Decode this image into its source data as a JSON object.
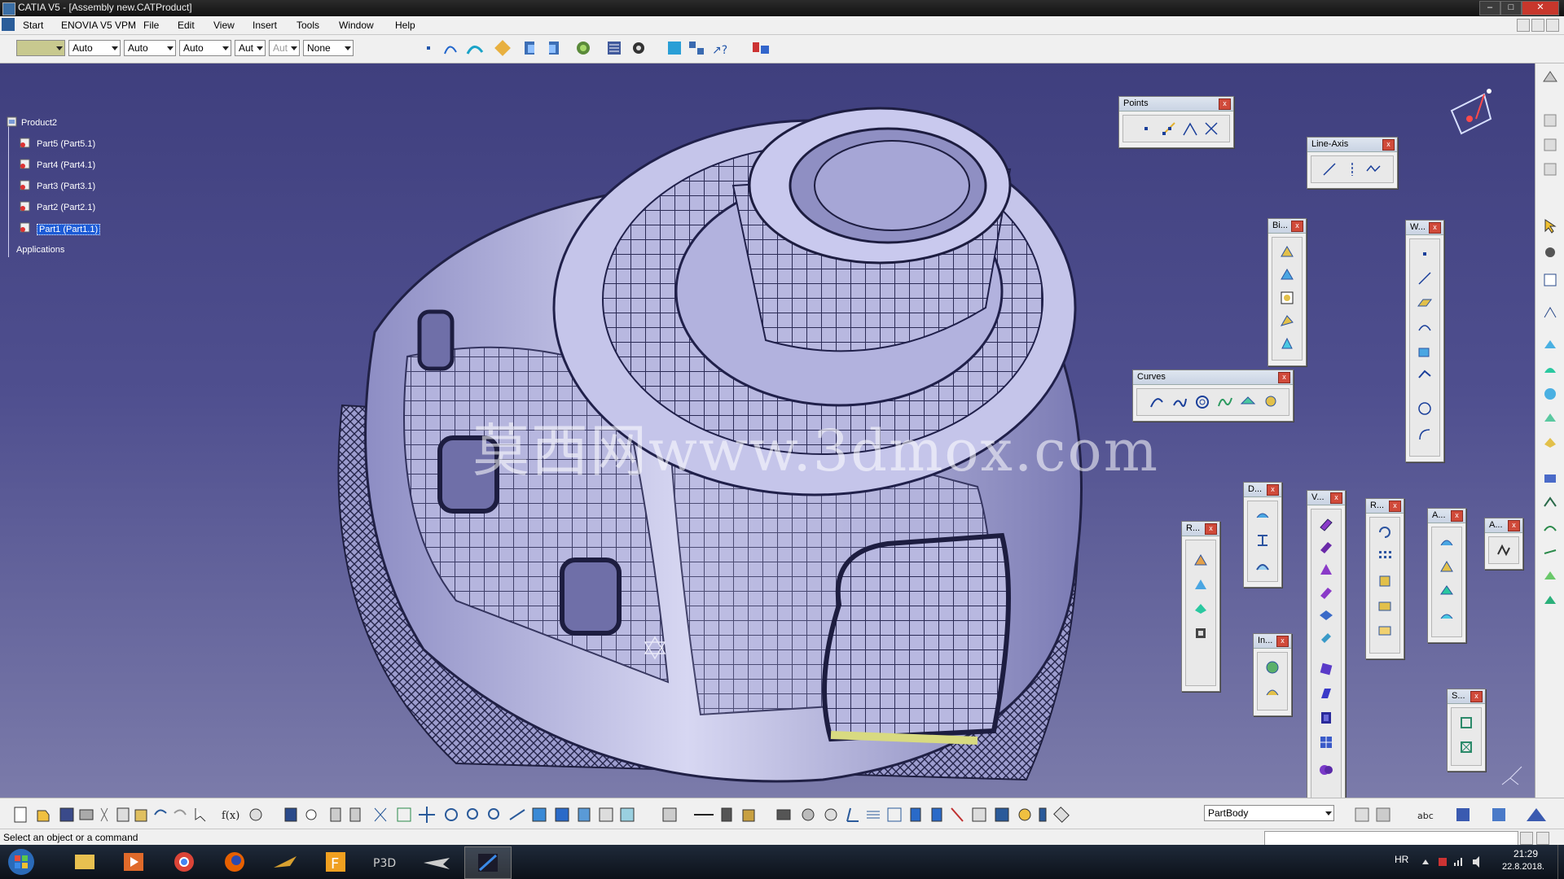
{
  "window": {
    "title": "CATIA V5 - [Assembly new.CATProduct]",
    "min_label": "–",
    "max_label": "□",
    "close_label": "✕"
  },
  "menubar": {
    "items": [
      "Start",
      "ENOVIA V5 VPM",
      "File",
      "Edit",
      "View",
      "Insert",
      "Tools",
      "Window",
      "Help"
    ]
  },
  "toolbar": {
    "color_value": "",
    "line_type": "Auto",
    "line_weight": "Auto",
    "layer": "Auto",
    "combo4": "Aut",
    "combo5": "Aut",
    "none_value": "None"
  },
  "tree": {
    "root": "Product2",
    "parts": [
      "Part5 (Part5.1)",
      "Part4 (Part4.1)",
      "Part3 (Part3.1)",
      "Part2 (Part2.1)",
      "Part1 (Part1.1)"
    ],
    "selected_index": 4,
    "applications": "Applications"
  },
  "floating_toolbars": {
    "points": "Points",
    "line_axis": "Line-Axis",
    "bi": "Bi...",
    "w": "W...",
    "curves": "Curves",
    "d": "D...",
    "v": "V...",
    "r1": "R...",
    "r2": "R...",
    "a1": "A...",
    "a2": "A...",
    "in": "In...",
    "s": "S..."
  },
  "watermark": "莫西网www.3dmox.com",
  "bottom": {
    "body_select": "PartBody"
  },
  "status": {
    "message": "Select an object or a command"
  },
  "taskbar": {
    "lang": "HR",
    "time": "21:29",
    "date": "22.8.2018."
  },
  "colors": {
    "viewport_top": "#3f3f7e",
    "viewport_bottom": "#7b7baa",
    "model": "#b9b9e2",
    "selection": "#1c5bd6"
  }
}
